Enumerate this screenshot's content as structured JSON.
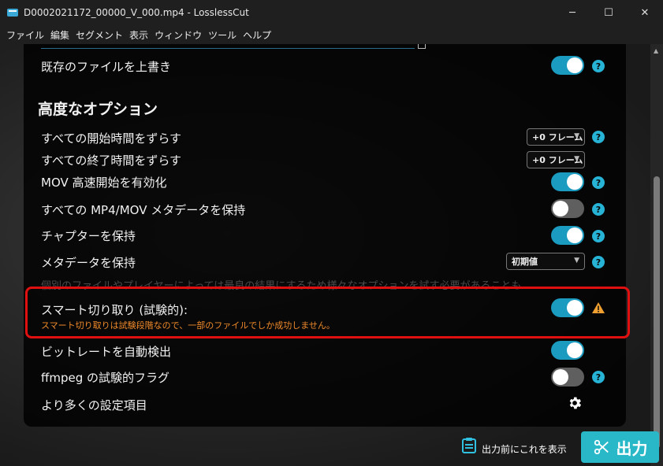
{
  "window": {
    "title": "D0002021172_00000_V_000.mp4 - LosslessCut",
    "minimize": "─",
    "maximize": "☐",
    "close": "✕"
  },
  "menu": [
    "ファイル",
    "編集",
    "セグメント",
    "表示",
    "ウィンドウ",
    "ツール",
    "ヘルプ"
  ],
  "settings": {
    "overwrite_label": "既存のファイルを上書き",
    "advanced_title": "高度なオプション",
    "shift_start_label": "すべての開始時間をずらす",
    "shift_start_value": "+0 フレーム",
    "shift_end_label": "すべての終了時間をずらす",
    "shift_end_value": "+0 フレーム",
    "mov_faststart_label": "MOV 高速開始を有効化",
    "keep_metadata_all_label": "すべての MP4/MOV メタデータを保持",
    "keep_chapters_label": "チャプターを保持",
    "keep_metadata_label": "メタデータを保持",
    "keep_metadata_value": "初期値",
    "faded_text": "個別のファイルやプレイヤーによっては最良の結果にするため様々なオプションを試す必要があることも",
    "smart_cut_label": "スマート切り取り (試験的):",
    "smart_cut_warning": "スマート切り取りは試験段階なので、一部のファイルでしか成功しません。",
    "auto_bitrate_label": "ビットレートを自動検出",
    "ffmpeg_flags_label": "ffmpeg の試験的フラグ",
    "more_settings_label": "より多くの設定項目"
  },
  "help_glyph": "?",
  "footer": {
    "show_before_export": "出力前にこれを表示",
    "export_label": "出力"
  },
  "colors": {
    "accent": "#1b9bc0",
    "help": "#26b3d6",
    "warning": "#f08a2a",
    "highlight": "#e01010",
    "export": "#28b8c8"
  },
  "toggles": {
    "overwrite": true,
    "mov_faststart": true,
    "keep_metadata_all": false,
    "keep_chapters": true,
    "smart_cut": true,
    "auto_bitrate": true,
    "ffmpeg_flags": false
  }
}
